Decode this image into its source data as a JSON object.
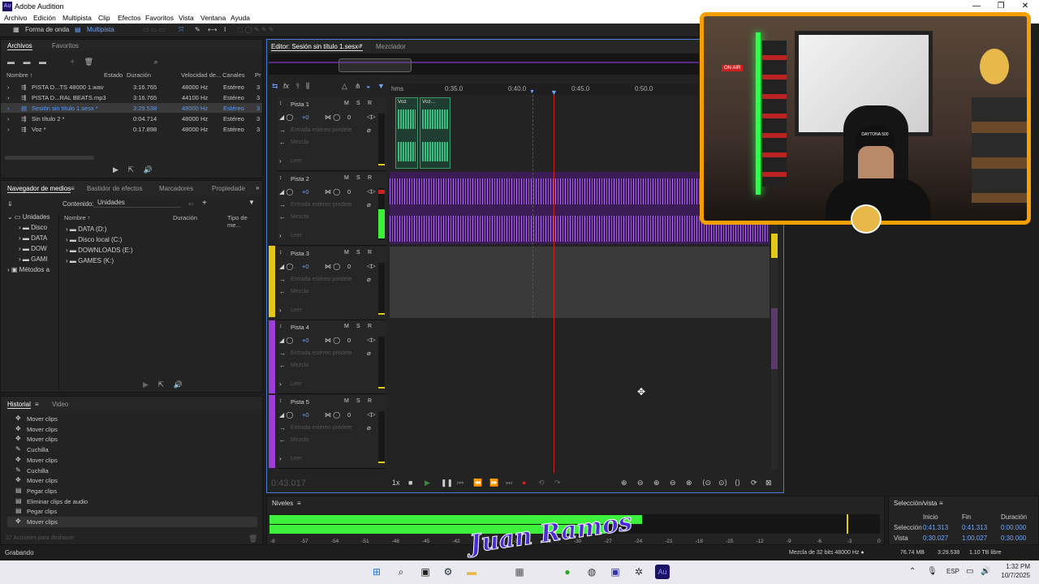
{
  "app": {
    "title": "Adobe Audition",
    "logo": "Au"
  },
  "window_controls": {
    "minimize": "—",
    "maximize": "❐",
    "close": "✕"
  },
  "menu": [
    "Archivo",
    "Edición",
    "Multipista",
    "Clip",
    "Efectos",
    "Favoritos",
    "Vista",
    "Ventana",
    "Ayuda"
  ],
  "toolbar": {
    "waveform": "Forma de onda",
    "multitrack": "Multipista"
  },
  "files_panel": {
    "tabs": [
      "Archivos",
      "Favoritos"
    ],
    "columns": [
      "Nombre ↑",
      "Estado",
      "Duración",
      "Velocidad de...",
      "Canales",
      "Pr"
    ],
    "rows": [
      {
        "name": "PISTA D...TS 48000 1.wav",
        "duration": "3:16.765",
        "rate": "48000 Hz",
        "channels": "Estéreo",
        "extra": "3"
      },
      {
        "name": "PISTA D...RAL BEATS.mp3",
        "duration": "3:16.765",
        "rate": "44100 Hz",
        "channels": "Estéreo",
        "extra": "3"
      },
      {
        "name": "Sesión sin título 1.sesx *",
        "duration": "3:29.538",
        "rate": "48000 Hz",
        "channels": "Estéreo",
        "extra": "3"
      },
      {
        "name": "Sin título 2 *",
        "duration": "0:04.714",
        "rate": "48000 Hz",
        "channels": "Estéreo",
        "extra": "3"
      },
      {
        "name": "Voz *",
        "duration": "0:17.898",
        "rate": "48000 Hz",
        "channels": "Estéreo",
        "extra": "3"
      }
    ]
  },
  "media_panel": {
    "tabs": [
      "Navegador de medios",
      "Bastidor de efectos",
      "Marcadores",
      "Propiedade"
    ],
    "content_label": "Contenido:",
    "content_value": "Unidades",
    "tree": [
      "Unidades",
      "Disco",
      "DATA",
      "DOW",
      "GAMI",
      "Métodos a"
    ],
    "columns": [
      "Nombre ↑",
      "Duración",
      "Tipo de me..."
    ],
    "drives": [
      "DATA (D:)",
      "Disco local (C:)",
      "DOWNLOADS (E:)",
      "GAMES (K:)"
    ]
  },
  "history_panel": {
    "tabs": [
      "Historial",
      "Video"
    ],
    "items": [
      "Mover clips",
      "Mover clips",
      "Mover clips",
      "Cuchilla",
      "Mover clips",
      "Cuchilla",
      "Mover clips",
      "Pegar clips",
      "Eliminar clips de audio",
      "Pegar clips",
      "Mover clips"
    ],
    "status": "27 Acciones para deshacer"
  },
  "editor": {
    "tabs": [
      "Editor: Sesión sin título 1.sesx *",
      "Mezclador"
    ],
    "ruler": [
      "hms",
      "0:35.0",
      "0:40.0",
      "0:45.0",
      "0:50.0"
    ],
    "tracks": [
      {
        "name": "Pista 1",
        "vol": "+0",
        "pan": "0",
        "input": "Entrada estéreo predete",
        "mode": "Mezcla",
        "read": "Leer",
        "color": "#3a9a6a"
      },
      {
        "name": "Pista 2",
        "vol": "+0",
        "pan": "0",
        "input": "Entrada estéreo predete",
        "mode": "Mezcla",
        "read": "Leer",
        "color": "#9b3fd6"
      },
      {
        "name": "Pista 3",
        "vol": "+0",
        "pan": "0",
        "input": "Entrada estéreo predete",
        "mode": "Mezcla",
        "read": "Leer",
        "color": "#e3c81a"
      },
      {
        "name": "Pista 4",
        "vol": "+0",
        "pan": "0",
        "input": "Entrada estéreo predete",
        "mode": "Mezcla",
        "read": "Leer",
        "color": "#9b3fd6"
      },
      {
        "name": "Pista 5",
        "vol": "+0",
        "pan": "0",
        "input": "Entrada estéreo predete",
        "mode": "Mezcla",
        "read": "Leer",
        "color": "#9b3fd6"
      }
    ],
    "clips": [
      "Voz",
      "Voz..."
    ],
    "msr": [
      "M",
      "S",
      "R"
    ],
    "time": "0:43.017",
    "speed": "1x"
  },
  "levels": {
    "title": "Niveles",
    "ticks": [
      "-8",
      "-57",
      "-54",
      "-51",
      "-48",
      "-45",
      "-42",
      "-39",
      "-36",
      "-33",
      "-30",
      "-27",
      "-24",
      "-21",
      "-18",
      "-15",
      "-12",
      "-9",
      "-6",
      "-3",
      "0"
    ],
    "left_level": 0.61,
    "right_level": 0.55
  },
  "selection_panel": {
    "title": "Selección/vista",
    "headers": [
      "Inicio",
      "Fin",
      "Duración"
    ],
    "selection": {
      "label": "Selección",
      "start": "0:41.313",
      "end": "0:41.313",
      "dur": "0:00.000"
    },
    "view": {
      "label": "Vista",
      "start": "0:30.027",
      "end": "1:00.027",
      "dur": "0:30.000"
    }
  },
  "statusbar": {
    "left": "Grabando",
    "mix": "Mezcla de 32 bits 48000 Hz ●",
    "mem": "76.74 MB",
    "dur": "3:29.538",
    "free": "1.10 TB libre"
  },
  "webcam": {
    "sign": "ON AIR",
    "cap": "DAYTONA 500"
  },
  "watermark": "Juan Ramos",
  "taskbar": {
    "lang": "ESP",
    "time": "1:32 PM",
    "date": "10/7/2025"
  },
  "colors": {
    "accent": "#6ea6ff",
    "playhead": "#d02020",
    "meter": "#3cf03c",
    "webcam_border": "#f5a000"
  }
}
